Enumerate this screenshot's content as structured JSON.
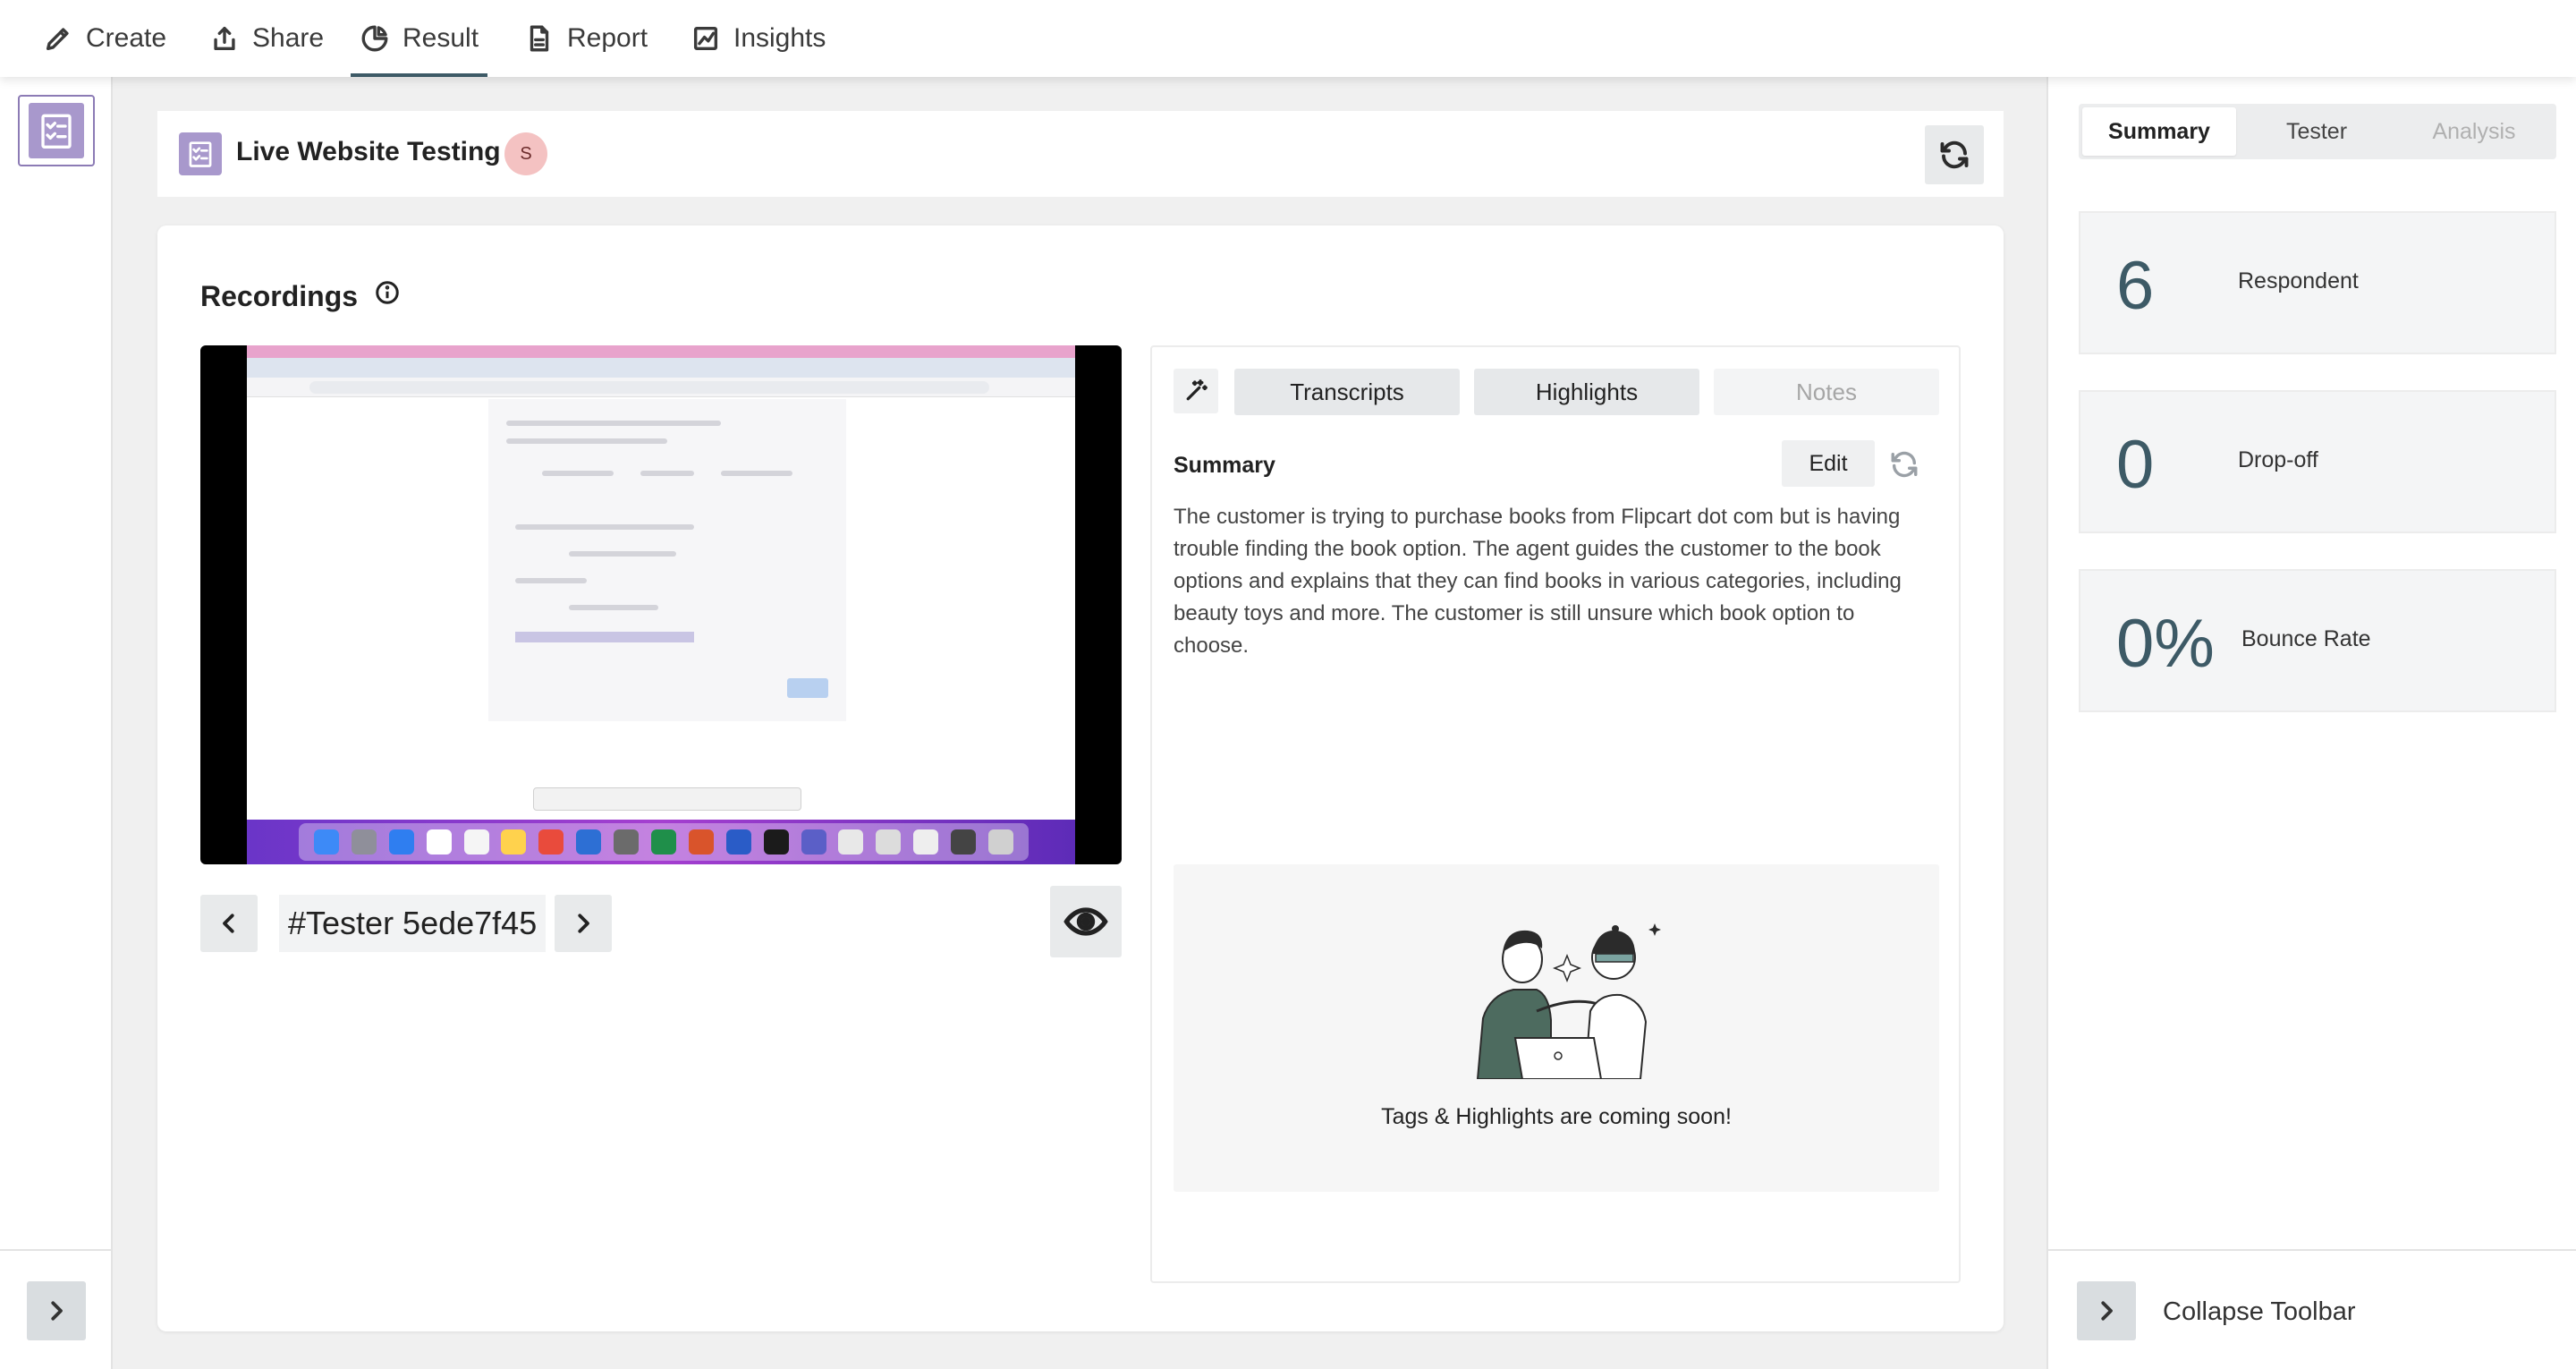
{
  "nav": {
    "items": [
      {
        "label": "Create",
        "icon": "pencil-icon"
      },
      {
        "label": "Share",
        "icon": "share-icon"
      },
      {
        "label": "Result",
        "icon": "pie-chart-icon",
        "active": true
      },
      {
        "label": "Report",
        "icon": "report-icon"
      },
      {
        "label": "Insights",
        "icon": "insights-icon"
      }
    ]
  },
  "study": {
    "title": "Live Website Testing",
    "avatar_initial": "S"
  },
  "recordings": {
    "title": "Recordings",
    "tester_label": "#Tester 5ede7f45"
  },
  "panel": {
    "tabs": [
      {
        "label": "Transcripts",
        "disabled": false
      },
      {
        "label": "Highlights",
        "disabled": false
      },
      {
        "label": "Notes",
        "disabled": true
      }
    ],
    "summary_label": "Summary",
    "edit_label": "Edit",
    "summary_text": "The customer is trying to purchase books from Flipcart dot com but is having trouble finding the book option. The agent guides the customer to the book options and explains that they can find books in various categories, including beauty toys and more. The customer is still unsure which book option to choose.",
    "coming_soon": "Tags & Highlights are coming soon!"
  },
  "sidebar": {
    "tabs": [
      {
        "label": "Summary",
        "state": "active"
      },
      {
        "label": "Tester",
        "state": "normal"
      },
      {
        "label": "Analysis",
        "state": "disabled"
      }
    ],
    "stats": [
      {
        "value": "6",
        "label": "Respondent"
      },
      {
        "value": "0",
        "label": "Drop-off"
      },
      {
        "value": "0%",
        "label": "Bounce Rate"
      }
    ],
    "collapse_label": "Collapse Toolbar"
  },
  "colors": {
    "accent": "#3d5a66",
    "study_icon": "#a898cc",
    "avatar_bg": "#f4c2c2"
  }
}
